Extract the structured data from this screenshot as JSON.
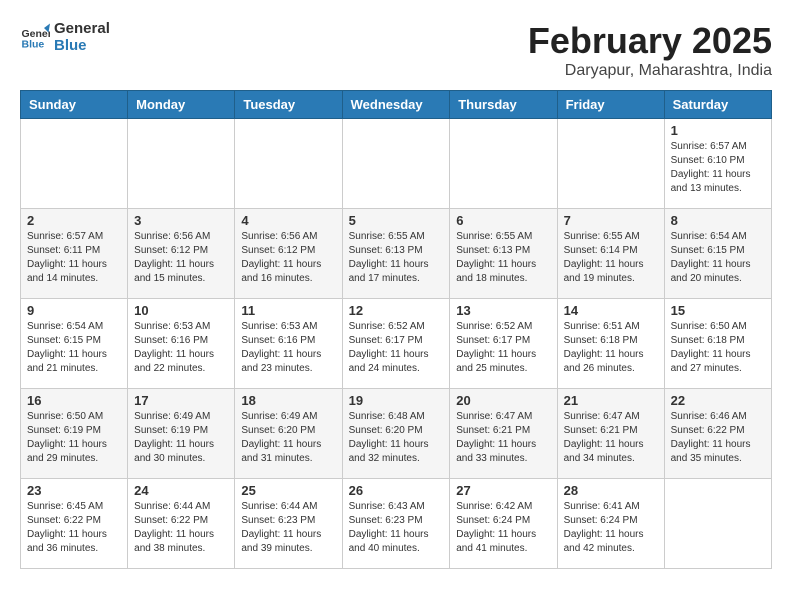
{
  "logo": {
    "line1": "General",
    "line2": "Blue"
  },
  "title": "February 2025",
  "subtitle": "Daryapur, Maharashtra, India",
  "days_of_week": [
    "Sunday",
    "Monday",
    "Tuesday",
    "Wednesday",
    "Thursday",
    "Friday",
    "Saturday"
  ],
  "weeks": [
    [
      {
        "day": "",
        "info": ""
      },
      {
        "day": "",
        "info": ""
      },
      {
        "day": "",
        "info": ""
      },
      {
        "day": "",
        "info": ""
      },
      {
        "day": "",
        "info": ""
      },
      {
        "day": "",
        "info": ""
      },
      {
        "day": "1",
        "info": "Sunrise: 6:57 AM\nSunset: 6:10 PM\nDaylight: 11 hours\nand 13 minutes."
      }
    ],
    [
      {
        "day": "2",
        "info": "Sunrise: 6:57 AM\nSunset: 6:11 PM\nDaylight: 11 hours\nand 14 minutes."
      },
      {
        "day": "3",
        "info": "Sunrise: 6:56 AM\nSunset: 6:12 PM\nDaylight: 11 hours\nand 15 minutes."
      },
      {
        "day": "4",
        "info": "Sunrise: 6:56 AM\nSunset: 6:12 PM\nDaylight: 11 hours\nand 16 minutes."
      },
      {
        "day": "5",
        "info": "Sunrise: 6:55 AM\nSunset: 6:13 PM\nDaylight: 11 hours\nand 17 minutes."
      },
      {
        "day": "6",
        "info": "Sunrise: 6:55 AM\nSunset: 6:13 PM\nDaylight: 11 hours\nand 18 minutes."
      },
      {
        "day": "7",
        "info": "Sunrise: 6:55 AM\nSunset: 6:14 PM\nDaylight: 11 hours\nand 19 minutes."
      },
      {
        "day": "8",
        "info": "Sunrise: 6:54 AM\nSunset: 6:15 PM\nDaylight: 11 hours\nand 20 minutes."
      }
    ],
    [
      {
        "day": "9",
        "info": "Sunrise: 6:54 AM\nSunset: 6:15 PM\nDaylight: 11 hours\nand 21 minutes."
      },
      {
        "day": "10",
        "info": "Sunrise: 6:53 AM\nSunset: 6:16 PM\nDaylight: 11 hours\nand 22 minutes."
      },
      {
        "day": "11",
        "info": "Sunrise: 6:53 AM\nSunset: 6:16 PM\nDaylight: 11 hours\nand 23 minutes."
      },
      {
        "day": "12",
        "info": "Sunrise: 6:52 AM\nSunset: 6:17 PM\nDaylight: 11 hours\nand 24 minutes."
      },
      {
        "day": "13",
        "info": "Sunrise: 6:52 AM\nSunset: 6:17 PM\nDaylight: 11 hours\nand 25 minutes."
      },
      {
        "day": "14",
        "info": "Sunrise: 6:51 AM\nSunset: 6:18 PM\nDaylight: 11 hours\nand 26 minutes."
      },
      {
        "day": "15",
        "info": "Sunrise: 6:50 AM\nSunset: 6:18 PM\nDaylight: 11 hours\nand 27 minutes."
      }
    ],
    [
      {
        "day": "16",
        "info": "Sunrise: 6:50 AM\nSunset: 6:19 PM\nDaylight: 11 hours\nand 29 minutes."
      },
      {
        "day": "17",
        "info": "Sunrise: 6:49 AM\nSunset: 6:19 PM\nDaylight: 11 hours\nand 30 minutes."
      },
      {
        "day": "18",
        "info": "Sunrise: 6:49 AM\nSunset: 6:20 PM\nDaylight: 11 hours\nand 31 minutes."
      },
      {
        "day": "19",
        "info": "Sunrise: 6:48 AM\nSunset: 6:20 PM\nDaylight: 11 hours\nand 32 minutes."
      },
      {
        "day": "20",
        "info": "Sunrise: 6:47 AM\nSunset: 6:21 PM\nDaylight: 11 hours\nand 33 minutes."
      },
      {
        "day": "21",
        "info": "Sunrise: 6:47 AM\nSunset: 6:21 PM\nDaylight: 11 hours\nand 34 minutes."
      },
      {
        "day": "22",
        "info": "Sunrise: 6:46 AM\nSunset: 6:22 PM\nDaylight: 11 hours\nand 35 minutes."
      }
    ],
    [
      {
        "day": "23",
        "info": "Sunrise: 6:45 AM\nSunset: 6:22 PM\nDaylight: 11 hours\nand 36 minutes."
      },
      {
        "day": "24",
        "info": "Sunrise: 6:44 AM\nSunset: 6:22 PM\nDaylight: 11 hours\nand 38 minutes."
      },
      {
        "day": "25",
        "info": "Sunrise: 6:44 AM\nSunset: 6:23 PM\nDaylight: 11 hours\nand 39 minutes."
      },
      {
        "day": "26",
        "info": "Sunrise: 6:43 AM\nSunset: 6:23 PM\nDaylight: 11 hours\nand 40 minutes."
      },
      {
        "day": "27",
        "info": "Sunrise: 6:42 AM\nSunset: 6:24 PM\nDaylight: 11 hours\nand 41 minutes."
      },
      {
        "day": "28",
        "info": "Sunrise: 6:41 AM\nSunset: 6:24 PM\nDaylight: 11 hours\nand 42 minutes."
      },
      {
        "day": "",
        "info": ""
      }
    ]
  ]
}
